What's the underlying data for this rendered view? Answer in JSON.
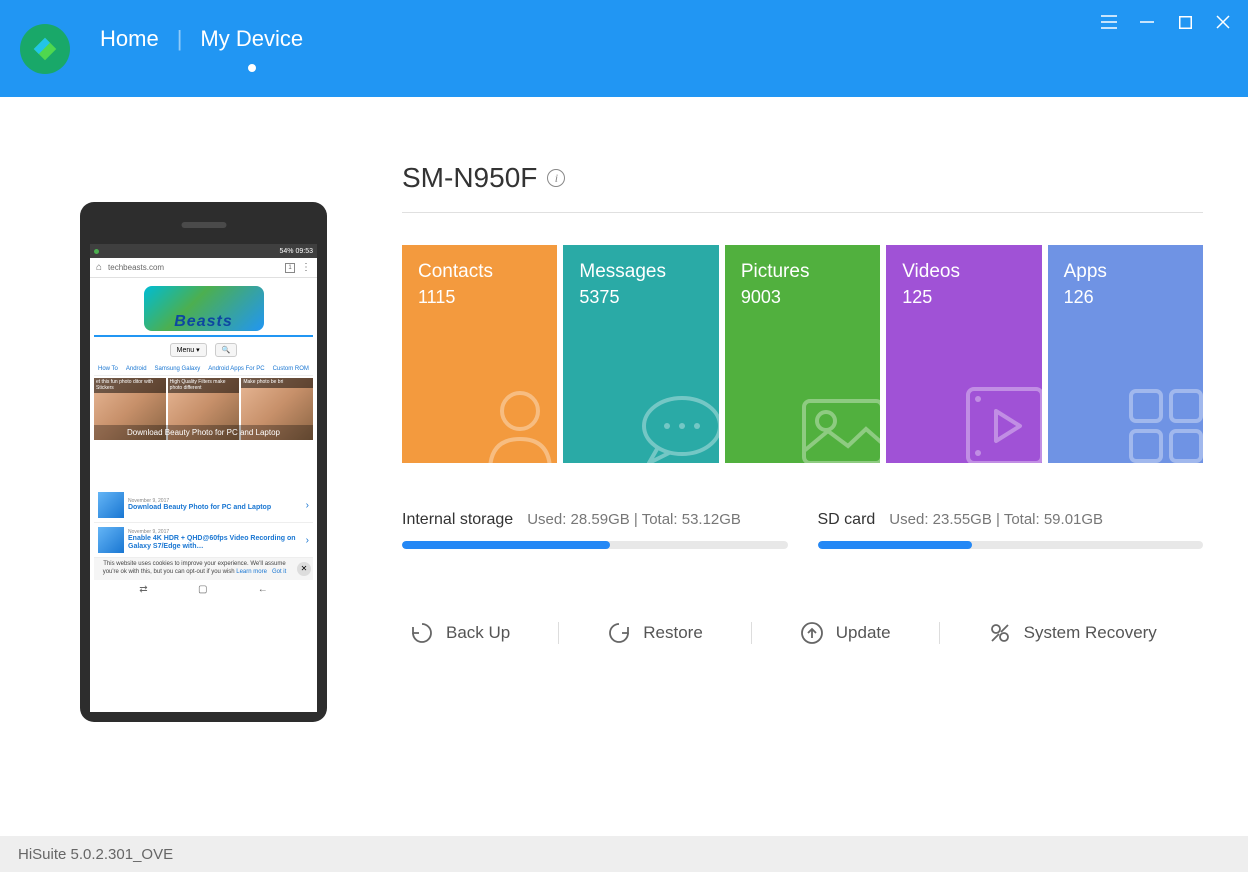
{
  "header": {
    "nav": {
      "home": "Home",
      "my_device": "My Device"
    }
  },
  "device": {
    "name": "SM-N950F"
  },
  "tiles": {
    "contacts": {
      "label": "Contacts",
      "count": "1115"
    },
    "messages": {
      "label": "Messages",
      "count": "5375"
    },
    "pictures": {
      "label": "Pictures",
      "count": "9003"
    },
    "videos": {
      "label": "Videos",
      "count": "125"
    },
    "apps": {
      "label": "Apps",
      "count": "126"
    }
  },
  "storage": {
    "internal": {
      "label": "Internal storage",
      "stats": "Used: 28.59GB | Total: 53.12GB",
      "pct": 54
    },
    "sd": {
      "label": "SD card",
      "stats": "Used: 23.55GB | Total: 59.01GB",
      "pct": 40
    }
  },
  "actions": {
    "backup": "Back Up",
    "restore": "Restore",
    "update": "Update",
    "recovery": "System Recovery"
  },
  "footer": {
    "version": "HiSuite 5.0.2.301_OVE"
  },
  "phone": {
    "status_right": "54% 09:53",
    "url": "techbeasts.com",
    "tab_count": "1",
    "logo_text": "Beasts",
    "menu_label": "Menu ▾",
    "nav_items": [
      "How To",
      "Android",
      "Samsung Galaxy",
      "Android Apps For PC",
      "Custom ROM"
    ],
    "thumb1": "et this fun photo ditor with Stickers",
    "thumb2": "High Quality Filters make photo different",
    "thumb3": "Make photo be bri",
    "thumb_overlay": "Download Beauty Photo for PC and Laptop",
    "art1_date": "November 9, 2017",
    "art1_title": "Download Beauty Photo for PC and Laptop",
    "art2_date": "November 9, 2017",
    "art2_title": "Enable 4K HDR + QHD@60fps Video Recording on Galaxy S7/Edge with…",
    "cookie_text": "This website uses cookies to improve your experience. We'll assume you're ok with this, but you can opt-out if you wish",
    "cookie_learn": "Learn more",
    "cookie_got": "Got it"
  }
}
